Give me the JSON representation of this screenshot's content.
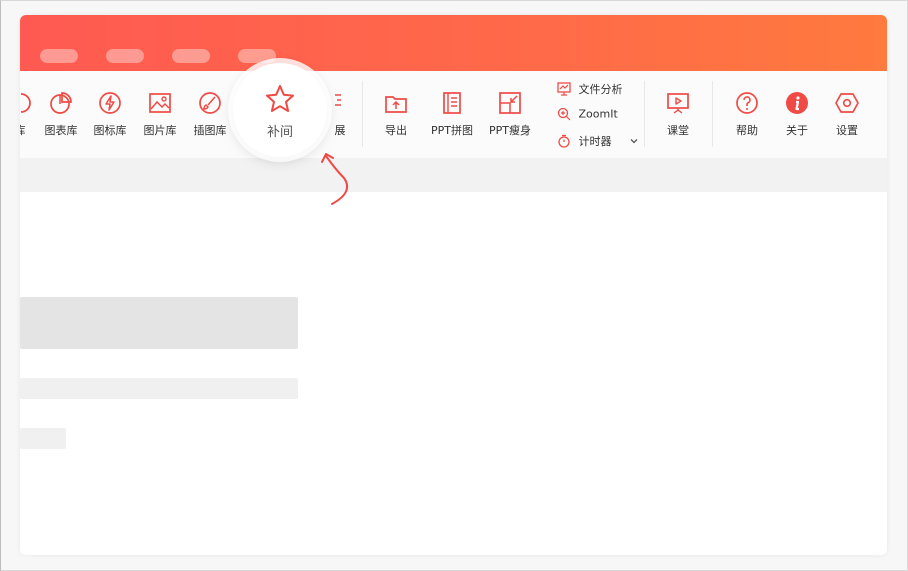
{
  "colors": {
    "accent": "#ff5a52",
    "accent_gradient_end": "#ff7a3e",
    "icon": "#ef4a45"
  },
  "ribbon": {
    "items": [
      {
        "name": "ribbon-item-partial",
        "label": "库",
        "icon": "partial-icon"
      },
      {
        "name": "ribbon-item-chart-library",
        "label": "图表库",
        "icon": "pie-chart-icon"
      },
      {
        "name": "ribbon-item-icon-library",
        "label": "图标库",
        "icon": "lightning-icon"
      },
      {
        "name": "ribbon-item-image-library",
        "label": "图片库",
        "icon": "image-icon"
      },
      {
        "name": "ribbon-item-illustration-library",
        "label": "插图库",
        "icon": "brush-icon"
      },
      {
        "name": "ribbon-item-extend",
        "label": "展",
        "icon": "extend-icon"
      },
      {
        "name": "ribbon-item-export",
        "label": "导出",
        "icon": "export-icon"
      },
      {
        "name": "ribbon-item-ppt-merge",
        "label": "PPT拼图",
        "icon": "merge-icon"
      },
      {
        "name": "ribbon-item-ppt-slim",
        "label": "PPT瘦身",
        "icon": "compress-icon"
      },
      {
        "name": "ribbon-item-classroom",
        "label": "课堂",
        "icon": "presentation-icon"
      },
      {
        "name": "ribbon-item-help",
        "label": "帮助",
        "icon": "help-icon"
      },
      {
        "name": "ribbon-item-about",
        "label": "关于",
        "icon": "info-icon"
      },
      {
        "name": "ribbon-item-settings",
        "label": "设置",
        "icon": "hexagon-settings-icon"
      }
    ],
    "small_items": [
      {
        "label": "文件分析",
        "icon": "file-analysis-icon"
      },
      {
        "label": "ZoomIt",
        "icon": "zoom-icon"
      },
      {
        "label": "计时器",
        "icon": "timer-icon"
      }
    ]
  },
  "spotlight": {
    "label": "补间",
    "icon": "star-icon"
  }
}
